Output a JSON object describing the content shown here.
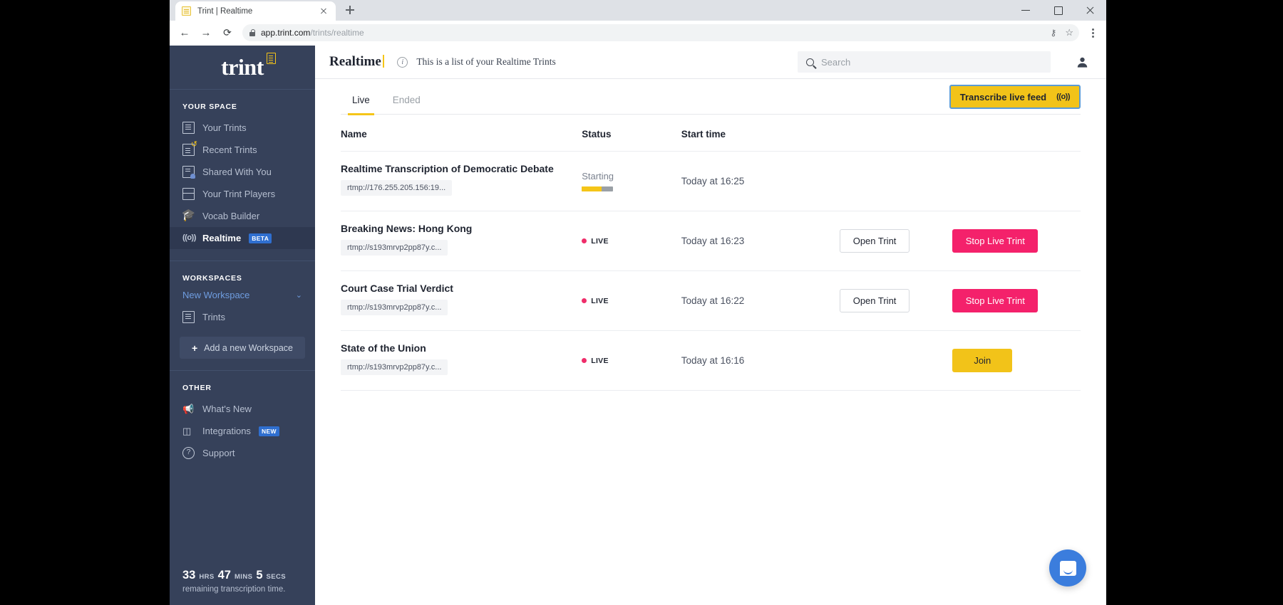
{
  "browser": {
    "tab_title": "Trint | Realtime",
    "new_tab_label": "+",
    "url_domain": "app.trint.com",
    "url_path": "/trints/realtime",
    "back_glyph": "←",
    "forward_glyph": "→",
    "reload_glyph": "⟳",
    "key_glyph": "⚷",
    "star_glyph": "☆"
  },
  "sidebar": {
    "logo_text": "trint",
    "sections": [
      {
        "heading": "YOUR SPACE",
        "items": [
          {
            "label": "Your Trints",
            "icon": "document-icon",
            "active": false,
            "badge": ""
          },
          {
            "label": "Recent Trints",
            "icon": "recent-document-icon",
            "active": false,
            "badge": ""
          },
          {
            "label": "Shared With You",
            "icon": "shared-document-icon",
            "active": false,
            "badge": ""
          },
          {
            "label": "Your Trint Players",
            "icon": "player-icon",
            "active": false,
            "badge": ""
          },
          {
            "label": "Vocab Builder",
            "icon": "graduation-cap-icon",
            "active": false,
            "badge": ""
          },
          {
            "label": "Realtime",
            "icon": "broadcast-icon",
            "active": true,
            "badge": "BETA"
          }
        ]
      },
      {
        "heading": "WORKSPACES",
        "workspace_name": "New Workspace",
        "chevron": "⌄",
        "items": [
          {
            "label": "Trints",
            "icon": "document-icon",
            "active": false,
            "badge": ""
          }
        ],
        "add_workspace_label": "Add a new Workspace",
        "add_workspace_plus": "+"
      },
      {
        "heading": "OTHER",
        "items": [
          {
            "label": "What's New",
            "icon": "megaphone-icon",
            "active": false,
            "badge": ""
          },
          {
            "label": "Integrations",
            "icon": "cubes-icon",
            "active": false,
            "badge": "NEW"
          },
          {
            "label": "Support",
            "icon": "question-circle-icon",
            "active": false,
            "badge": ""
          }
        ]
      }
    ],
    "footer": {
      "hours": "33",
      "hours_unit": "HRS",
      "minutes": "47",
      "minutes_unit": "MINS",
      "seconds": "5",
      "seconds_unit": "SECS",
      "caption": "remaining transcription time."
    }
  },
  "topbar": {
    "title": "Realtime",
    "subtitle": "This is a list of your Realtime Trints",
    "info_glyph": "i",
    "search_placeholder": "Search",
    "avatar_glyph": "●"
  },
  "main": {
    "tabs": [
      {
        "label": "Live",
        "active": true
      },
      {
        "label": "Ended",
        "active": false
      }
    ],
    "cta": {
      "label": "Transcribe live feed",
      "icon_glyph": "((o))"
    },
    "table": {
      "headers": [
        "Name",
        "Status",
        "Start time",
        "",
        ""
      ],
      "rows": [
        {
          "name": "Realtime Transcription of Democratic Debate",
          "url": "rtmp://176.255.205.156:19...",
          "status_type": "starting",
          "status_label": "Starting",
          "progress_pct": 62,
          "start_time": "Today at 16:25",
          "action_primary": "",
          "action_secondary": ""
        },
        {
          "name": "Breaking News: Hong Kong",
          "url": "rtmp://s193mrvp2pp87y.c...",
          "status_type": "live",
          "status_label": "LIVE",
          "progress_pct": 0,
          "start_time": "Today at 16:23",
          "action_primary": "Open Trint",
          "action_secondary": "Stop Live Trint"
        },
        {
          "name": "Court Case Trial Verdict",
          "url": "rtmp://s193mrvp2pp87y.c...",
          "status_type": "live",
          "status_label": "LIVE",
          "progress_pct": 0,
          "start_time": "Today at 16:22",
          "action_primary": "Open Trint",
          "action_secondary": "Stop Live Trint"
        },
        {
          "name": "State of the Union",
          "url": "rtmp://s193mrvp2pp87y.c...",
          "status_type": "live",
          "status_label": "LIVE",
          "progress_pct": 0,
          "start_time": "Today at 16:16",
          "action_primary": "",
          "action_secondary": "Join"
        }
      ]
    }
  },
  "colors": {
    "brand_yellow": "#f2c319",
    "sidebar_bg": "#36415a",
    "danger_pink": "#f4216b",
    "live_red": "#ef2d6a",
    "link_blue": "#6f9de0",
    "focus_blue": "#5b9bd5",
    "intercom_blue": "#3b7ddd"
  }
}
